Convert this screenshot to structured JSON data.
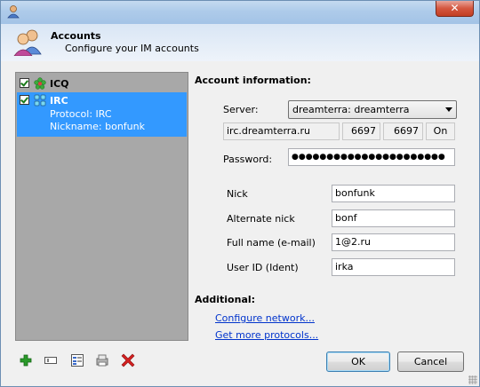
{
  "header": {
    "title": "Accounts",
    "subtitle": "Configure your IM accounts"
  },
  "accounts": [
    {
      "name": "ICQ",
      "checked": true,
      "selected": false,
      "icon": "icq-flower-icon"
    },
    {
      "name": "IRC",
      "checked": true,
      "selected": true,
      "icon": "irc-network-icon",
      "protocol": "Protocol: IRC",
      "nickname": "Nickname: bonfunk"
    }
  ],
  "toolbar_icons": [
    "add-account-icon",
    "rename-account-icon",
    "account-options-icon",
    "import-account-icon",
    "delete-account-icon"
  ],
  "account_info": {
    "title": "Account information:",
    "server_label": "Server:",
    "server_value": "dreamterra: dreamterra",
    "host": "irc.dreamterra.ru",
    "port_from": "6697",
    "port_to": "6697",
    "ssl": "On",
    "password_label": "Password:",
    "password_value": "●●●●●●●●●●●●●●●●●●●●●●",
    "nick_label": "Nick",
    "nick_value": "bonfunk",
    "alt_nick_label": "Alternate nick",
    "alt_nick_value": "bonf",
    "fullname_label": "Full name (e-mail)",
    "fullname_value": "1@2.ru",
    "userid_label": "User ID (Ident)",
    "userid_value": "irka"
  },
  "additional": {
    "title": "Additional:",
    "configure_network": "Configure network...",
    "get_more_protocols": "Get more protocols..."
  },
  "buttons": {
    "ok": "OK",
    "cancel": "Cancel",
    "close": "✕"
  },
  "colors": {
    "selection": "#3399ff",
    "list_background": "#a8a8a8",
    "link": "#0033cc",
    "delete": "#d42020",
    "add": "#2a9a2a"
  }
}
